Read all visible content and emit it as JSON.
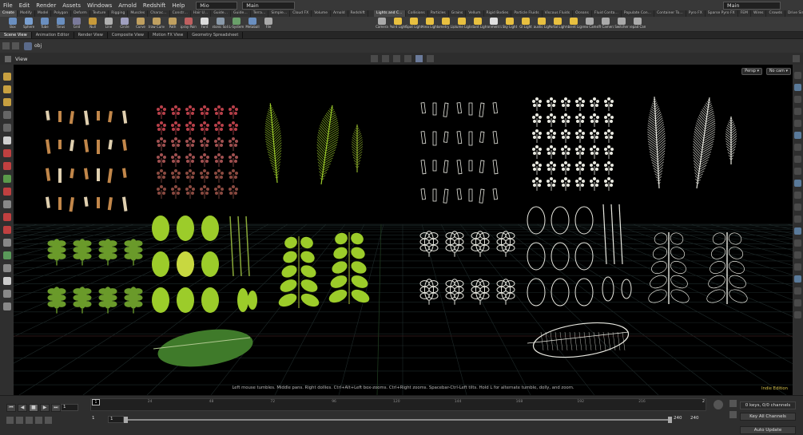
{
  "menu": {
    "items": [
      "File",
      "Edit",
      "Render",
      "Assets",
      "Windows",
      "Arnold",
      "Redshift",
      "Help"
    ]
  },
  "desktop_menu": "Mio",
  "main_menu": "Main",
  "right_main_menu": "Main",
  "left_shelf_tabs": [
    "Create",
    "Modify",
    "Model",
    "Polygon",
    "Deform",
    "Texture",
    "Rigging",
    "Muscles",
    "Charac…",
    "Constr…",
    "Hair U…",
    "Guide…",
    "Guide…",
    "Terra…",
    "Simple…",
    "Cloud FX",
    "Volume",
    "Arnold",
    "Redshift"
  ],
  "right_shelf_tabs": [
    "Lights and C…",
    "Collisions",
    "Particles",
    "Grains",
    "Vellum",
    "Rigid Bodies",
    "Particle Fluids",
    "Viscous Fluids",
    "Oceans",
    "Fluid Conta…",
    "Populate Con…",
    "Container To…",
    "Pyro FX",
    "Sparse Pyro FX",
    "FEM",
    "Wires",
    "Crowds",
    "Drive Simul…"
  ],
  "left_tools": [
    {
      "label": "Box",
      "color": "#6a8fc0"
    },
    {
      "label": "Sphere",
      "color": "#7aa0d0"
    },
    {
      "label": "Tube",
      "color": "#6a8fc0"
    },
    {
      "label": "Torus",
      "color": "#6a8fc0"
    },
    {
      "label": "Grid",
      "color": "#7a7a9a"
    },
    {
      "label": "Null",
      "color": "#c79a3a"
    },
    {
      "label": "Line",
      "color": "#b0b0b0"
    },
    {
      "label": "Circle",
      "color": "#a0a0c0"
    },
    {
      "label": "Curve",
      "color": "#c0a060"
    },
    {
      "label": "Draw Curve",
      "color": "#c0a060"
    },
    {
      "label": "Path",
      "color": "#c0a060"
    },
    {
      "label": "Spray Paint",
      "color": "#c06060"
    },
    {
      "label": "Font",
      "color": "#dddddd"
    },
    {
      "label": "Platonic Solids",
      "color": "#8a9aaa"
    },
    {
      "label": "L-System",
      "color": "#6aa06a"
    },
    {
      "label": "Metaball",
      "color": "#6a8fc0"
    },
    {
      "label": "File",
      "color": "#aaaaaa"
    }
  ],
  "right_tools": [
    {
      "label": "Camera",
      "color": "#aaaaaa"
    },
    {
      "label": "Point Light",
      "color": "#e8c040"
    },
    {
      "label": "Spot Light",
      "color": "#e8c040"
    },
    {
      "label": "Area Light",
      "color": "#e8c040"
    },
    {
      "label": "Geometry Light",
      "color": "#e8c040"
    },
    {
      "label": "Volume Light",
      "color": "#e8c040"
    },
    {
      "label": "Distant Light",
      "color": "#e8c040"
    },
    {
      "label": "Environment Light",
      "color": "#e0e0e0"
    },
    {
      "label": "Sky Light",
      "color": "#e8c040"
    },
    {
      "label": "GI Light",
      "color": "#e8c040"
    },
    {
      "label": "Caustic Light",
      "color": "#e8c040"
    },
    {
      "label": "Portal Light",
      "color": "#e8c040"
    },
    {
      "label": "Ambient Light",
      "color": "#e8c040"
    },
    {
      "label": "Stereo Camera",
      "color": "#aaaaaa"
    },
    {
      "label": "VR Camera",
      "color": "#aaaaaa"
    },
    {
      "label": "Switcher",
      "color": "#aaaaaa"
    },
    {
      "label": "Gamepad Camera",
      "color": "#aaaaaa"
    }
  ],
  "pane_tabs": [
    "Scene View",
    "Animation Editor",
    "Render View",
    "Composite View",
    "Motion FX View",
    "Geometry Spreadsheet"
  ],
  "path": "obj",
  "view_label": "View",
  "persp_label": "Persp",
  "cam_label": "No cam",
  "status_message": "Left mouse tumbles. Middle pans. Right dollies. Ctrl+Alt+Left box-zooms. Ctrl+Right zooms. Spacebar-Ctrl-Left tilts. Hold L for alternate tumble, dolly, and zoom.",
  "edition": "Indie Edition",
  "timeline": {
    "ticks": [
      "24",
      "48",
      "72",
      "96",
      "120",
      "144",
      "168",
      "192",
      "216"
    ],
    "start_marker": "1",
    "end_marker": "2",
    "current_frame": "1",
    "range_start": "1",
    "range_start2": "1",
    "range_end": "240",
    "range_end2": "240",
    "keys": "0 keys, 0/0 channels",
    "key_all": "Key All Channels",
    "auto_update": "Auto Update"
  },
  "colors": {
    "leaf_green": "#6a9a2a",
    "bright_green": "#9ccc2a",
    "stem_orange": "#c2874a",
    "red_plant": "#b8404a",
    "wire": "#e8e8e0",
    "accent_yellow": "#d8c24a"
  }
}
